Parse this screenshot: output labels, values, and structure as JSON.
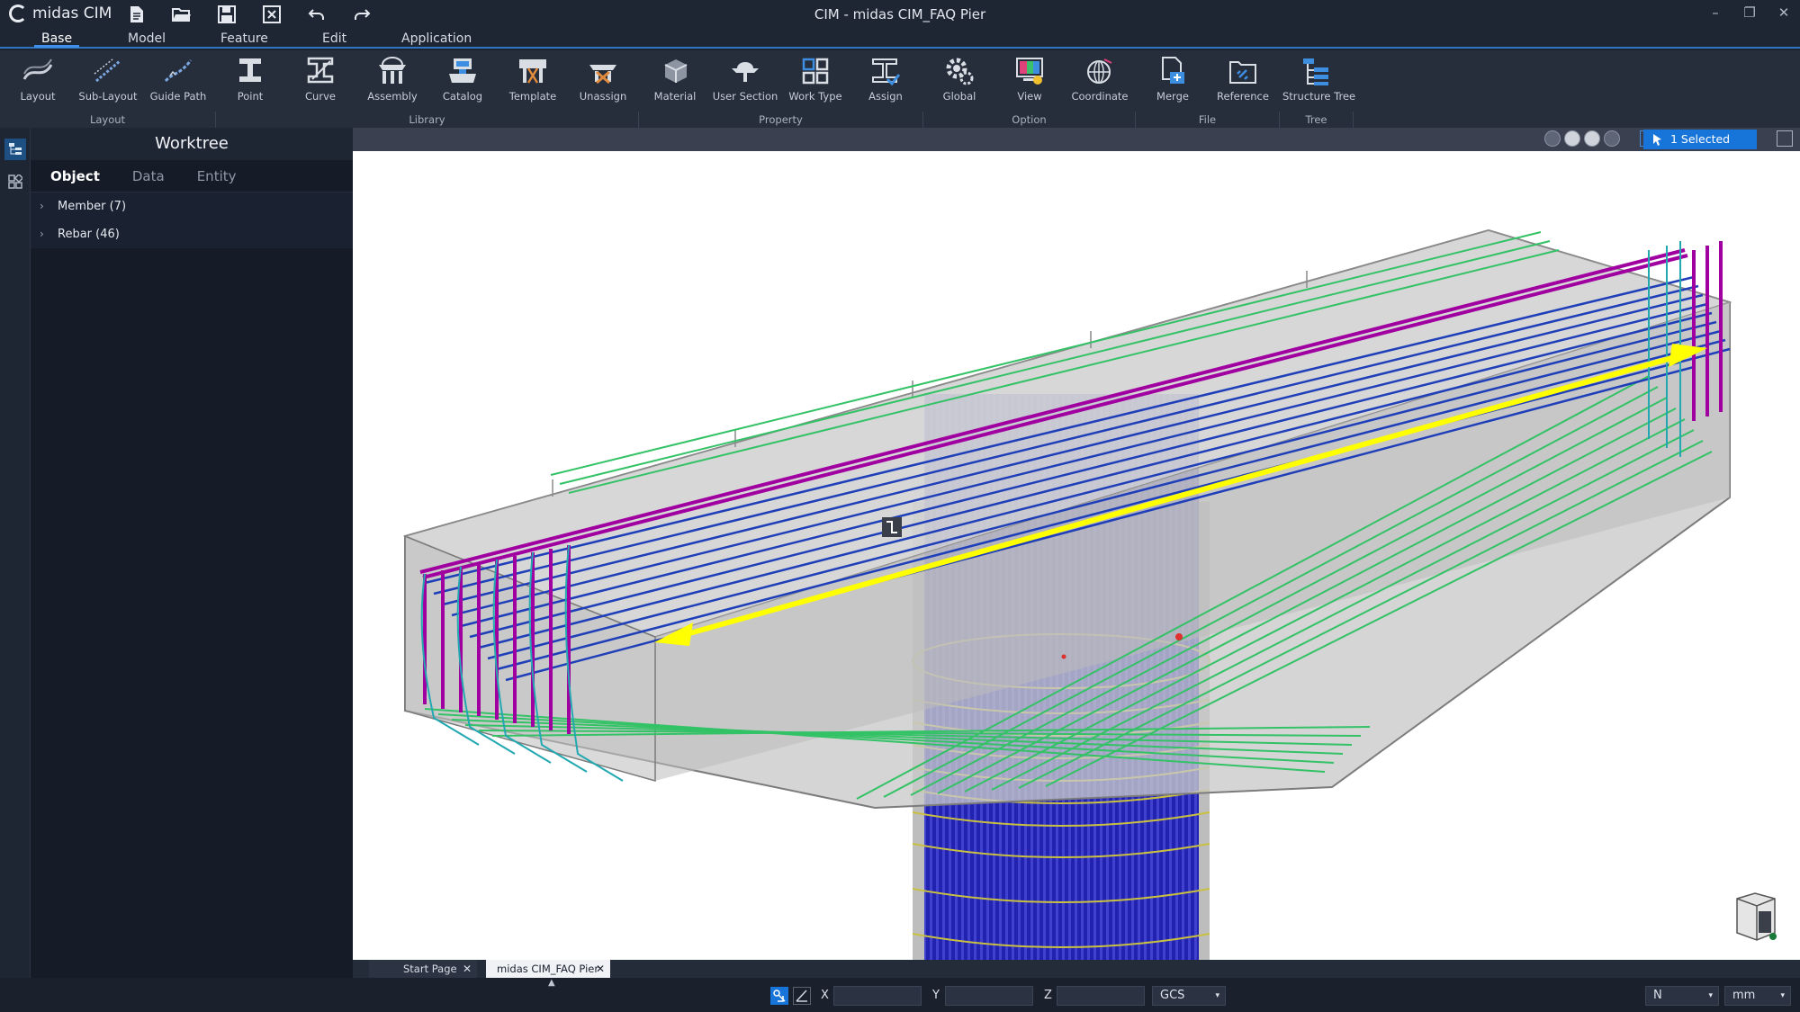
{
  "app": {
    "brand": "midas CIM",
    "window_title": "CIM - midas CIM_FAQ Pier"
  },
  "menu_tabs": [
    "Base",
    "Model",
    "Feature",
    "Edit",
    "Application"
  ],
  "ribbon": {
    "buttons": [
      "Layout",
      "Sub-Layout",
      "Guide Path",
      "Point",
      "Curve",
      "Assembly",
      "Catalog",
      "Template",
      "Unassign",
      "Material",
      "User Section",
      "Work Type",
      "Assign",
      "Global",
      "View",
      "Coordinate",
      "Merge",
      "Reference",
      "Structure Tree"
    ],
    "groups": [
      "Layout",
      "Library",
      "Property",
      "Option",
      "File",
      "Tree"
    ]
  },
  "worktree": {
    "title": "Worktree",
    "tabs": [
      "Object",
      "Data",
      "Entity"
    ],
    "items": [
      "Member (7)",
      "Rebar (46)"
    ]
  },
  "viewport": {
    "selection_status": "1 Selected"
  },
  "doc_tabs": [
    "Start Page",
    "midas CIM_FAQ Pier"
  ],
  "statusbar": {
    "x_label": "X",
    "y_label": "Y",
    "z_label": "Z",
    "coord_system": "GCS",
    "force_unit": "N",
    "length_unit": "mm"
  },
  "colors": {
    "accent": "#1774d9",
    "arrow": "#ffff00",
    "rebar_blue": "#1a1ab0",
    "rebar_green": "#33c266",
    "rebar_magenta": "#a000a0",
    "rebar_cyan": "#22a8b0"
  }
}
